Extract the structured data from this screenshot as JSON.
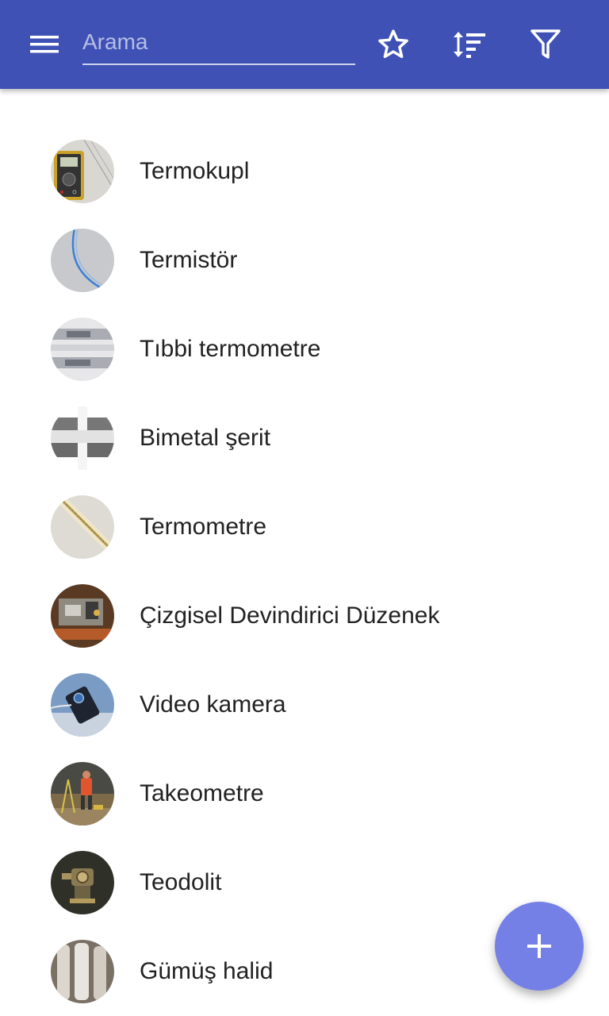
{
  "toolbar": {
    "menu_icon": "hamburger-menu-icon",
    "search_placeholder": "Arama",
    "search_value": "",
    "favorites_icon": "star-outline-icon",
    "sort_icon": "sort-icon",
    "filter_icon": "filter-icon"
  },
  "colors": {
    "appbar": "#3f51b5",
    "fab": "#7580e6",
    "text": "#222222"
  },
  "items": [
    {
      "label": "Termokupl",
      "thumb": "multimeter"
    },
    {
      "label": "Termistör",
      "thumb": "wire"
    },
    {
      "label": "Tıbbi termometre",
      "thumb": "thermometers"
    },
    {
      "label": "Bimetal şerit",
      "thumb": "bimetal"
    },
    {
      "label": "Termometre",
      "thumb": "glass-thermometer"
    },
    {
      "label": "Çizgisel Devindirici Düzenek",
      "thumb": "machine"
    },
    {
      "label": "Video kamera",
      "thumb": "camera"
    },
    {
      "label": "Takeometre",
      "thumb": "surveyor"
    },
    {
      "label": "Teodolit",
      "thumb": "theodolite"
    },
    {
      "label": "Gümüş halid",
      "thumb": "tubes"
    }
  ],
  "fab": {
    "icon": "plus-icon"
  }
}
